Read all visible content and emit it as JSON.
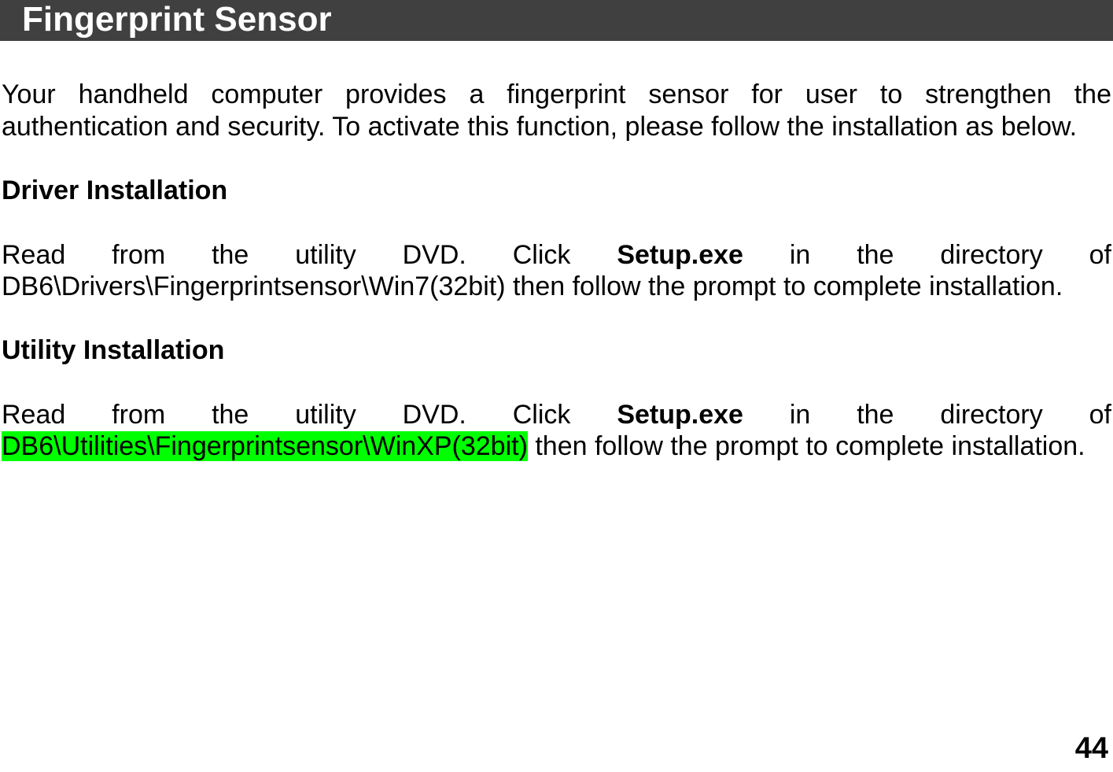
{
  "header": {
    "title": "Fingerprint Sensor"
  },
  "intro": "Your handheld computer provides a fingerprint sensor for user to strengthen the authentication and security. To activate this function, please follow the installation as below.",
  "sections": {
    "driver": {
      "heading": "Driver Installation",
      "pre": "Read from the utility DVD. Click ",
      "setup": "Setup.exe",
      "post": " in the directory of DB6\\Drivers\\Fingerprintsensor\\Win7(32bit) then follow the prompt to complete installation."
    },
    "utility": {
      "heading": "Utility Installation",
      "pre": "Read from the utility DVD. Click ",
      "setup": "Setup.exe",
      "mid1": " in the directory of ",
      "highlight": "DB6\\Utilities\\Fingerprintsensor\\WinXP(32bit)",
      "mid2": " then follow the prompt to complete installation."
    }
  },
  "page_number": "44"
}
